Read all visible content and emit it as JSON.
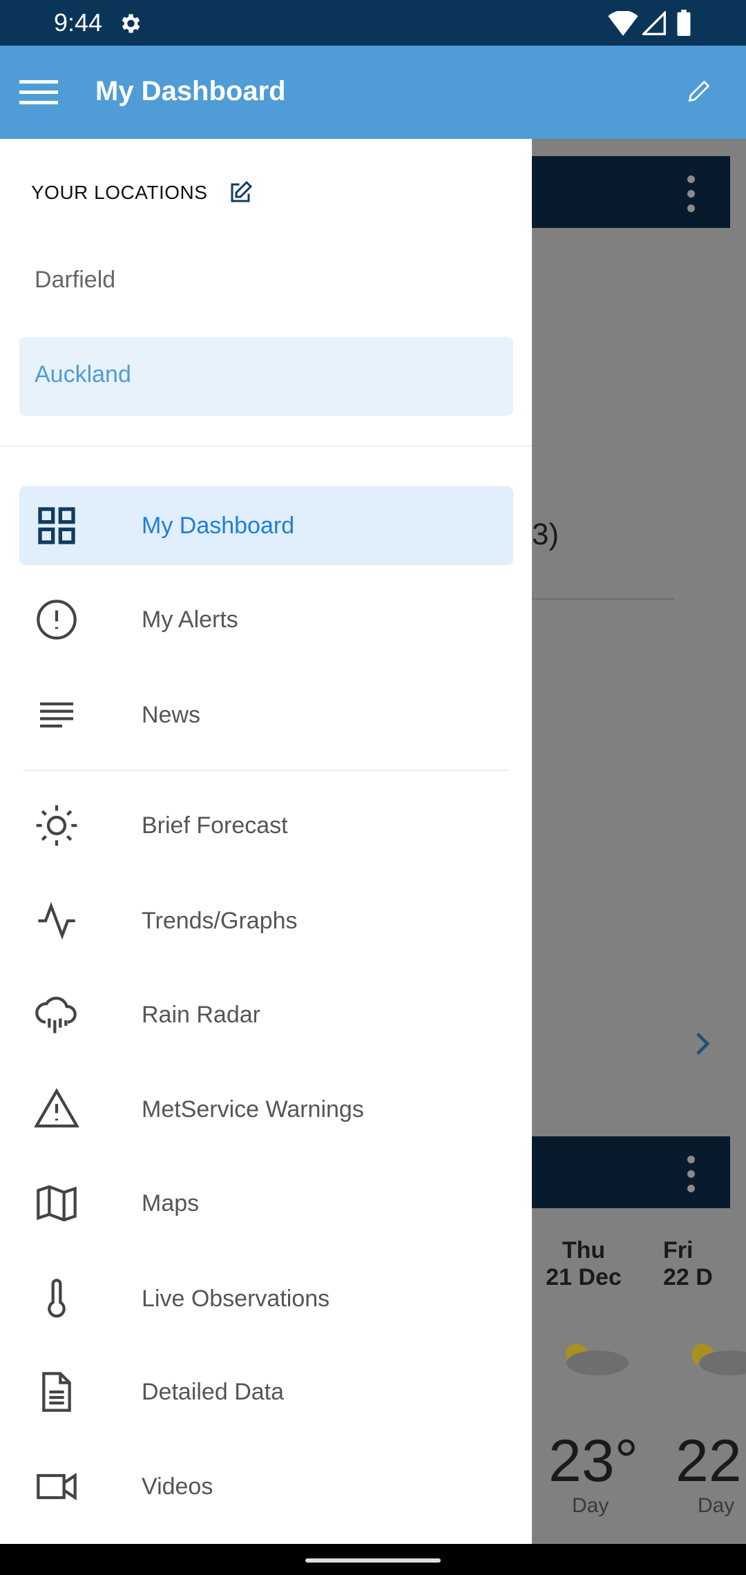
{
  "status_bar": {
    "time": "9:44",
    "icons": [
      "settings-gear-icon",
      "wifi-icon",
      "signal-icon",
      "battery-icon"
    ]
  },
  "app_bar": {
    "title": "My Dashboard",
    "menu_icon": "hamburger-icon",
    "edit_icon": "pencil-icon"
  },
  "drawer": {
    "locations_header": "YOUR LOCATIONS",
    "locations": [
      {
        "label": "Darfield",
        "selected": false
      },
      {
        "label": "Auckland",
        "selected": true
      }
    ],
    "menu": [
      {
        "label": "My Dashboard",
        "icon": "dashboard-grid-icon",
        "selected": true
      },
      {
        "label": "My Alerts",
        "icon": "alert-circle-icon"
      },
      {
        "label": "News",
        "icon": "news-lines-icon"
      },
      {
        "label": "Brief Forecast",
        "icon": "sun-icon"
      },
      {
        "label": "Trends/Graphs",
        "icon": "activity-graph-icon"
      },
      {
        "label": "Rain Radar",
        "icon": "rain-cloud-icon"
      },
      {
        "label": "MetService Warnings",
        "icon": "warning-triangle-icon"
      },
      {
        "label": "Maps",
        "icon": "map-icon"
      },
      {
        "label": "Live Observations",
        "icon": "thermometer-icon"
      },
      {
        "label": "Detailed Data",
        "icon": "document-icon"
      },
      {
        "label": "Videos",
        "icon": "video-camera-icon"
      }
    ]
  },
  "background": {
    "partial_text": "3)",
    "forecast": [
      {
        "day": "Thu",
        "date": "21 Dec",
        "temp": "23°",
        "period": "Day"
      },
      {
        "day": "Fri",
        "date": "22 D",
        "temp": "22",
        "period": "Day"
      }
    ]
  },
  "colors": {
    "status_bar": "#0b3558",
    "app_bar": "#4f9cd6",
    "accent": "#1f7fd9",
    "selected_bg": "#e1eefc"
  }
}
